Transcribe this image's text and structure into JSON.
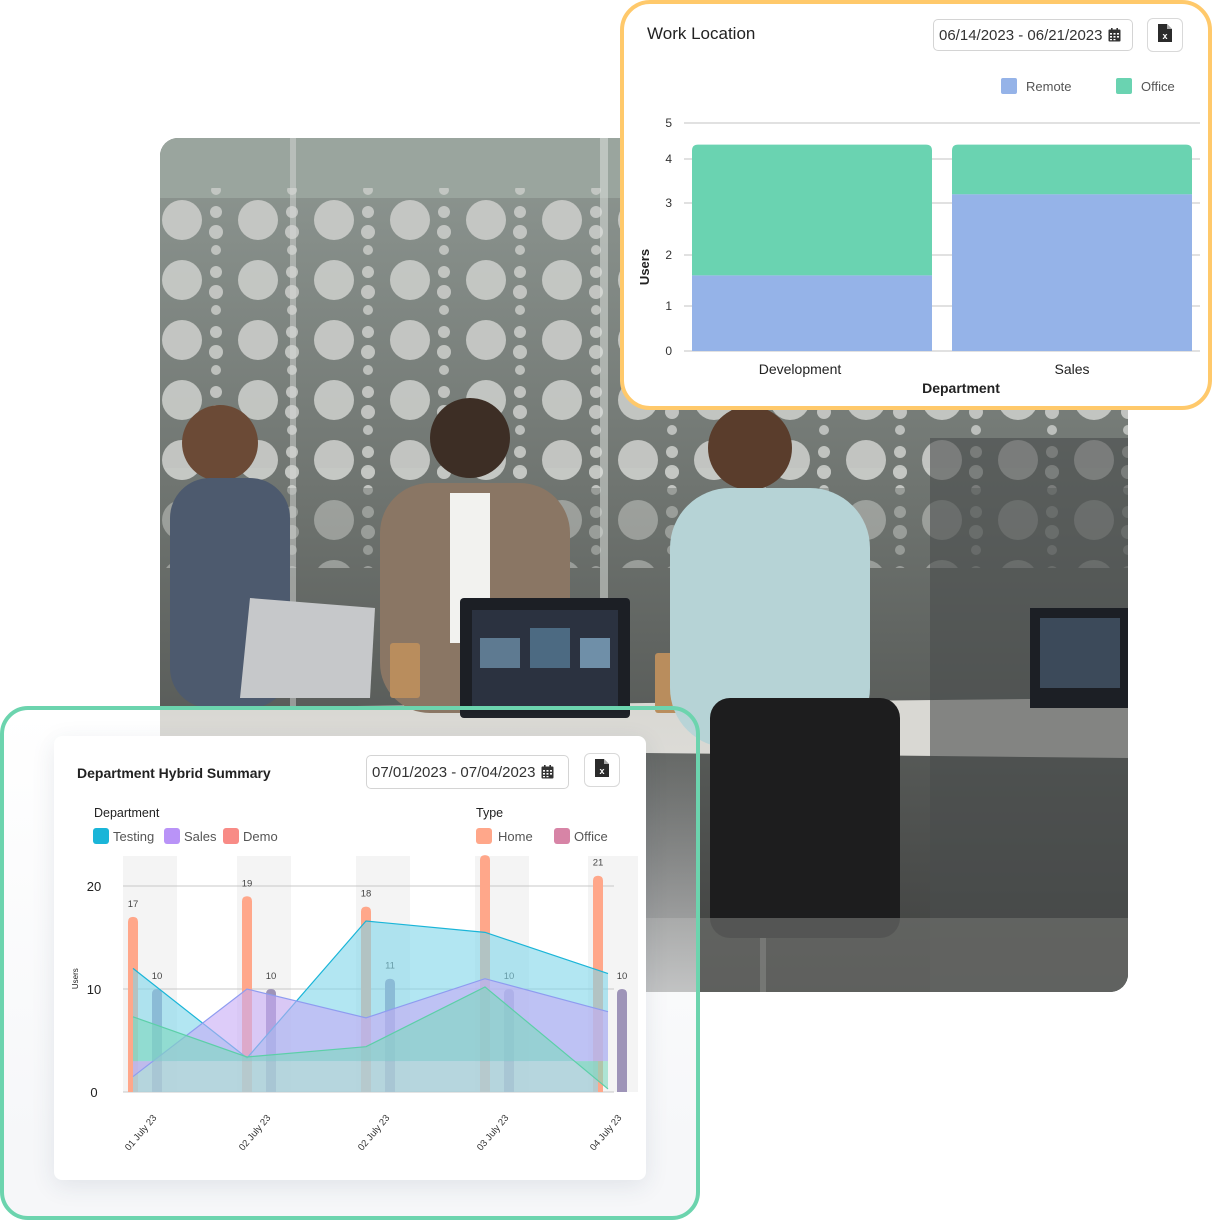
{
  "work_location": {
    "title": "Work Location",
    "date_range": "06/14/2023 - 06/21/2023",
    "calendar_icon": "calendar-icon",
    "export_icon": "excel-file-icon",
    "border_color": "#FFC96B"
  },
  "dept_hybrid": {
    "title": "Department Hybrid Summary",
    "date_range": "07/01/2023 - 07/04/2023",
    "calendar_icon": "calendar-icon",
    "export_icon": "excel-file-icon",
    "border_color": "#6CD4AE",
    "legend_department_title": "Department",
    "legend_type_title": "Type"
  },
  "photo": {
    "description": "Three colleagues working on laptops at a glass-walled meeting room table"
  },
  "chart_data": [
    {
      "type": "bar",
      "stacked": true,
      "title": "Work Location",
      "xlabel": "Department",
      "ylabel": "Users",
      "categories": [
        "Development",
        "Sales"
      ],
      "yticks": [
        0,
        1,
        2,
        3,
        4,
        5
      ],
      "ylim": [
        0,
        5
      ],
      "grid": true,
      "legend_position": "top-right",
      "series": [
        {
          "name": "Remote",
          "color": "#95B3E8",
          "values": [
            1.6,
            3.2
          ]
        },
        {
          "name": "Office",
          "color": "#6AD3B1",
          "values": [
            2.8,
            1.2
          ]
        }
      ]
    },
    {
      "type": "bar",
      "title": "Department Hybrid Summary",
      "xlabel": "",
      "ylabel": "Users",
      "categories": [
        "01 July 23",
        "02 July 23",
        "02 July 23",
        "03 July 23",
        "04 July 23"
      ],
      "yticks": [
        0,
        10,
        20
      ],
      "ylim": [
        0,
        22
      ],
      "grid": true,
      "legend_position": "top",
      "legend_groups": [
        {
          "title": "Department",
          "items": [
            {
              "name": "Testing",
              "color": "#1AB5D8"
            },
            {
              "name": "Sales",
              "color": "#B993F7"
            },
            {
              "name": "Demo",
              "color": "#F88B86"
            }
          ]
        },
        {
          "title": "Type",
          "items": [
            {
              "name": "Home",
              "color": "#FFA78A"
            },
            {
              "name": "Office",
              "color": "#D784A6"
            }
          ]
        }
      ],
      "bar_series": [
        {
          "name": "Home",
          "color": "#FFA78A",
          "values": [
            17,
            19,
            18,
            23,
            21
          ]
        },
        {
          "name": "Office",
          "color": "#9E94B8",
          "values": [
            10,
            10,
            11,
            10,
            10
          ]
        }
      ],
      "area_series": [
        {
          "name": "Testing",
          "color": "#1AB5D8",
          "values": [
            12,
            3.3,
            16.6,
            15.5,
            11.5
          ]
        },
        {
          "name": "Sales",
          "color": "#8E9CF0",
          "values": [
            1.5,
            10,
            7.2,
            11,
            7.8
          ]
        },
        {
          "name": "Demo",
          "color": "#5CCFA8",
          "values": [
            7.3,
            3.4,
            4.4,
            10.2,
            0.3
          ]
        }
      ],
      "baseline_band": 3
    }
  ]
}
